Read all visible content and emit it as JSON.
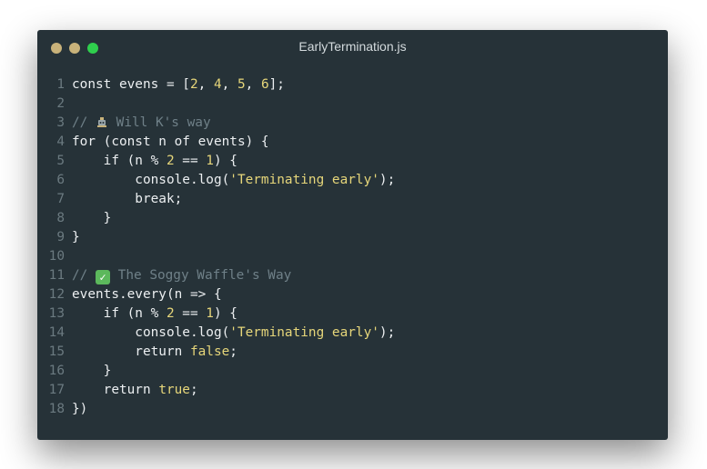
{
  "window": {
    "title": "EarlyTermination.js",
    "traffic_lights": [
      {
        "name": "close",
        "color": "#c8b27a"
      },
      {
        "name": "minimize",
        "color": "#c8b27a"
      },
      {
        "name": "zoom",
        "color": "#2fcf4d"
      }
    ]
  },
  "code": {
    "lines": [
      {
        "n": "1",
        "tokens": [
          {
            "t": "const evens = [",
            "k": "plain"
          },
          {
            "t": "2",
            "k": "number"
          },
          {
            "t": ", ",
            "k": "plain"
          },
          {
            "t": "4",
            "k": "number"
          },
          {
            "t": ", ",
            "k": "plain"
          },
          {
            "t": "5",
            "k": "number"
          },
          {
            "t": ", ",
            "k": "plain"
          },
          {
            "t": "6",
            "k": "number"
          },
          {
            "t": "];",
            "k": "plain"
          }
        ]
      },
      {
        "n": "2",
        "tokens": []
      },
      {
        "n": "3",
        "tokens": [
          {
            "t": "// ",
            "k": "comment"
          },
          {
            "icon": "robot-icon"
          },
          {
            "t": " Will K's way",
            "k": "comment"
          }
        ]
      },
      {
        "n": "4",
        "tokens": [
          {
            "t": "for (const n of events) {",
            "k": "plain"
          }
        ]
      },
      {
        "n": "5",
        "tokens": [
          {
            "t": "    if (n % ",
            "k": "plain"
          },
          {
            "t": "2",
            "k": "number"
          },
          {
            "t": " == ",
            "k": "plain"
          },
          {
            "t": "1",
            "k": "number"
          },
          {
            "t": ") {",
            "k": "plain"
          }
        ]
      },
      {
        "n": "6",
        "tokens": [
          {
            "t": "        console.log(",
            "k": "plain"
          },
          {
            "t": "'Terminating early'",
            "k": "string"
          },
          {
            "t": ");",
            "k": "plain"
          }
        ]
      },
      {
        "n": "7",
        "tokens": [
          {
            "t": "        break;",
            "k": "plain"
          }
        ]
      },
      {
        "n": "8",
        "tokens": [
          {
            "t": "    }",
            "k": "plain"
          }
        ]
      },
      {
        "n": "9",
        "tokens": [
          {
            "t": "}",
            "k": "plain"
          }
        ]
      },
      {
        "n": "10",
        "tokens": []
      },
      {
        "n": "11",
        "tokens": [
          {
            "t": "// ",
            "k": "comment"
          },
          {
            "icon": "check-mark-icon"
          },
          {
            "t": " The Soggy Waffle's Way",
            "k": "comment"
          }
        ]
      },
      {
        "n": "12",
        "tokens": [
          {
            "t": "events.every(n => {",
            "k": "plain"
          }
        ]
      },
      {
        "n": "13",
        "tokens": [
          {
            "t": "    if (n % ",
            "k": "plain"
          },
          {
            "t": "2",
            "k": "number"
          },
          {
            "t": " == ",
            "k": "plain"
          },
          {
            "t": "1",
            "k": "number"
          },
          {
            "t": ") {",
            "k": "plain"
          }
        ]
      },
      {
        "n": "14",
        "tokens": [
          {
            "t": "        console.log(",
            "k": "plain"
          },
          {
            "t": "'Terminating early'",
            "k": "string"
          },
          {
            "t": ");",
            "k": "plain"
          }
        ]
      },
      {
        "n": "15",
        "tokens": [
          {
            "t": "        return ",
            "k": "plain"
          },
          {
            "t": "false",
            "k": "keyword"
          },
          {
            "t": ";",
            "k": "plain"
          }
        ]
      },
      {
        "n": "16",
        "tokens": [
          {
            "t": "    }",
            "k": "plain"
          }
        ]
      },
      {
        "n": "17",
        "tokens": [
          {
            "t": "    return ",
            "k": "plain"
          },
          {
            "t": "true",
            "k": "keyword"
          },
          {
            "t": ";",
            "k": "plain"
          }
        ]
      },
      {
        "n": "18",
        "tokens": [
          {
            "t": "})",
            "k": "plain"
          }
        ]
      }
    ]
  }
}
